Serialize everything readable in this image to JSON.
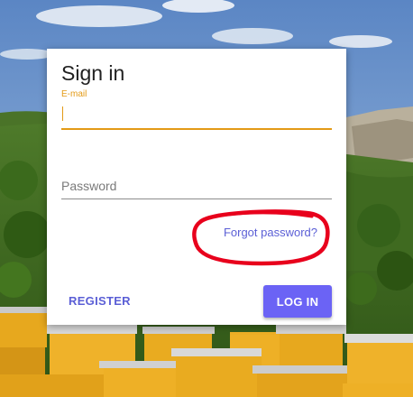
{
  "form": {
    "title": "Sign in",
    "email_label": "E-mail",
    "email_value": "",
    "password_placeholder": "Password",
    "forgot_link": "Forgot password?",
    "register_label": "REGISTER",
    "login_label": "LOG IN"
  },
  "colors": {
    "accent": "#e39a16",
    "primary": "#6b63f5",
    "link": "#5b5fd6",
    "annotation": "#e8001c"
  }
}
